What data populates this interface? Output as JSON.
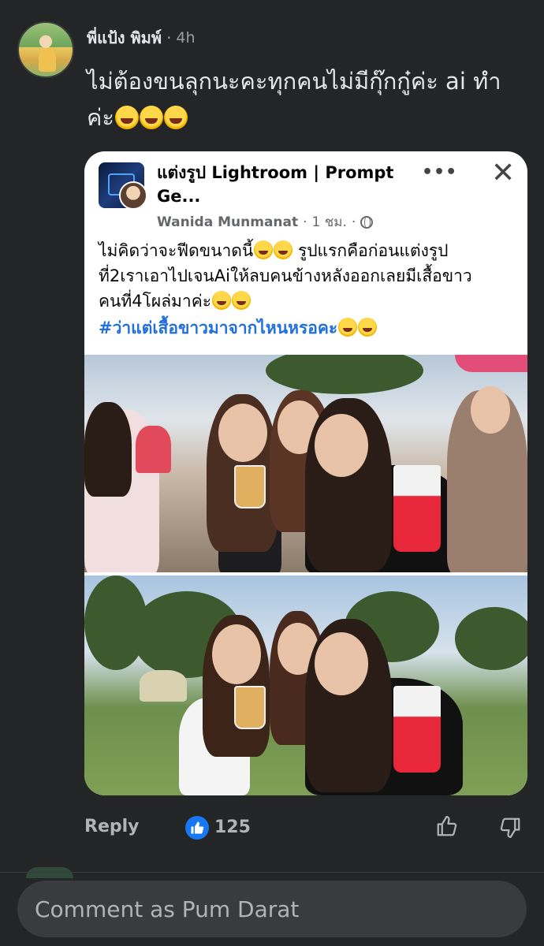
{
  "comment": {
    "author": "พี่แป้ง พิมพ์",
    "separator": "·",
    "time": "4h",
    "text": "ไม่ต้องขนลุกนะคะทุกคนไม่มีกุ๊กกู๋ค่ะ ai ทำค่ะ",
    "emoji_icon": "rolling-on-floor-laughing-emoji"
  },
  "shared_post": {
    "group_name": "แต่งรูป Lightroom | Prompt Ge...",
    "more_label": "•••",
    "close_label": "✕",
    "post_author": "Wanida Munmanat",
    "post_time": "1 ชม.",
    "meta_separator": "·",
    "text_line1": "ไม่คิดว่าจะฟีดขนาดนี้",
    "text_line1b": " รูปแรกคือก่อนแต่งรูป",
    "text_line2": "ที่2เราเอาไปเจนAiให้ลบคนข้างหลังออกเลยมีเสื้อขาว",
    "text_line3": "คนที่4โผล่มาค่ะ",
    "hashtag": "#ว่าแต่เสื้อขาวมาจากไหนหรอคะ"
  },
  "actions": {
    "reply_label": "Reply",
    "like_count": "125"
  },
  "composer": {
    "placeholder": "Comment as Pum Darat"
  },
  "colors": {
    "background": "#242527",
    "card": "#ffffff",
    "link_blue": "#216fdb",
    "like_blue": "#1877f2"
  }
}
